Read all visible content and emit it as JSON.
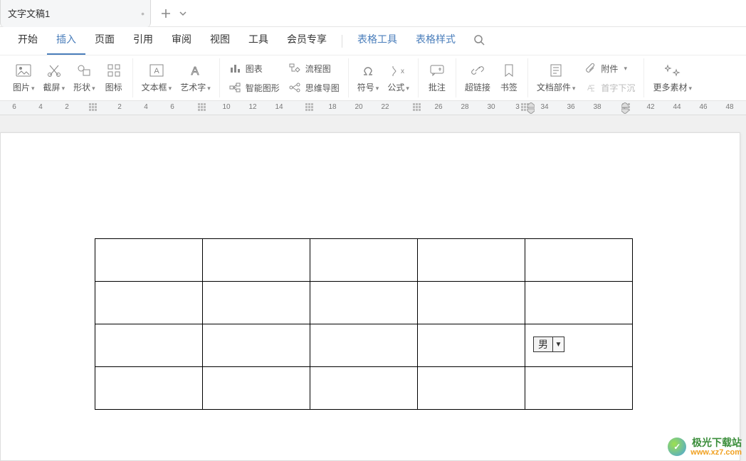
{
  "tab": {
    "title": "文字文稿1"
  },
  "menu": {
    "items": [
      "开始",
      "插入",
      "页面",
      "引用",
      "审阅",
      "视图",
      "工具",
      "会员专享"
    ],
    "active_index": 1,
    "context_items": [
      "表格工具",
      "表格样式"
    ]
  },
  "ribbon": {
    "g1": {
      "pic": "图片",
      "screenshot": "截屏",
      "shape": "形状",
      "icon": "图标"
    },
    "g2": {
      "textbox": "文本框",
      "art": "艺术字"
    },
    "g3": {
      "chart": "图表",
      "flow": "流程图",
      "smart": "智能图形",
      "mind": "思维导图"
    },
    "g4": {
      "symbol": "符号",
      "formula": "公式"
    },
    "g5": {
      "comment": "批注"
    },
    "g6": {
      "hyperlink": "超链接",
      "bookmark": "书签"
    },
    "g7": {
      "docpart": "文档部件",
      "attach": "附件",
      "dropcap": "首字下沉"
    },
    "g8": {
      "more": "更多素材"
    }
  },
  "ruler": {
    "left_ticks": [
      "6",
      "4",
      "2"
    ],
    "right_ticks": [
      "2",
      "4",
      "6",
      "10",
      "12",
      "14",
      "18",
      "20",
      "22",
      "26",
      "28",
      "30",
      "3",
      "34",
      "36",
      "38",
      "4",
      "42",
      "44",
      "46",
      "48"
    ]
  },
  "table": {
    "rows": 4,
    "cols": 5,
    "field": {
      "value": "男",
      "row": 2,
      "col": 4
    }
  },
  "watermark": {
    "brand": "极光下载站",
    "url": "www.xz7.com"
  }
}
